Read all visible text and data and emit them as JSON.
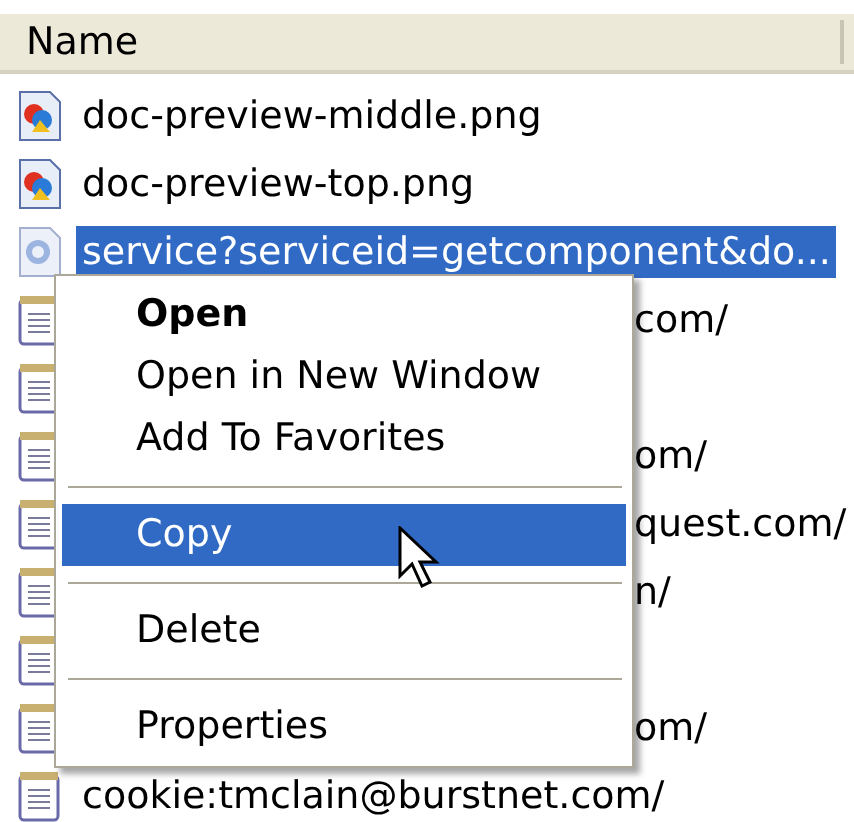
{
  "table": {
    "columns": [
      "Name"
    ],
    "rows": [
      {
        "kind": "image",
        "name": "doc-preview-middle.png",
        "selected": false
      },
      {
        "kind": "image",
        "name": "doc-preview-top.png",
        "selected": false
      },
      {
        "kind": "web",
        "name": "service?serviceid=getcomponent&do...",
        "selected": true
      },
      {
        "kind": "text",
        "name": "com/",
        "selected": false
      },
      {
        "kind": "text",
        "selected": false
      },
      {
        "kind": "text",
        "name": "om/",
        "selected": false
      },
      {
        "kind": "text",
        "name": "quest.com/",
        "selected": false
      },
      {
        "kind": "text",
        "name": "n/",
        "selected": false
      },
      {
        "kind": "text",
        "selected": false
      },
      {
        "kind": "text",
        "name": "om/",
        "selected": false
      },
      {
        "kind": "text",
        "name": "cookie:tmclain@burstnet.com/",
        "selected": false
      }
    ]
  },
  "context_menu": {
    "items": [
      {
        "kind": "item",
        "label": "Open",
        "bold": true,
        "selected": false
      },
      {
        "kind": "item",
        "label": "Open in New Window",
        "bold": false,
        "selected": false
      },
      {
        "kind": "item",
        "label": "Add To Favorites",
        "bold": false,
        "selected": false
      },
      {
        "kind": "separator"
      },
      {
        "kind": "item",
        "label": "Copy",
        "bold": false,
        "selected": true
      },
      {
        "kind": "separator"
      },
      {
        "kind": "item",
        "label": "Delete",
        "bold": false,
        "selected": false
      },
      {
        "kind": "separator"
      },
      {
        "kind": "item",
        "label": "Properties",
        "bold": false,
        "selected": false
      }
    ]
  }
}
